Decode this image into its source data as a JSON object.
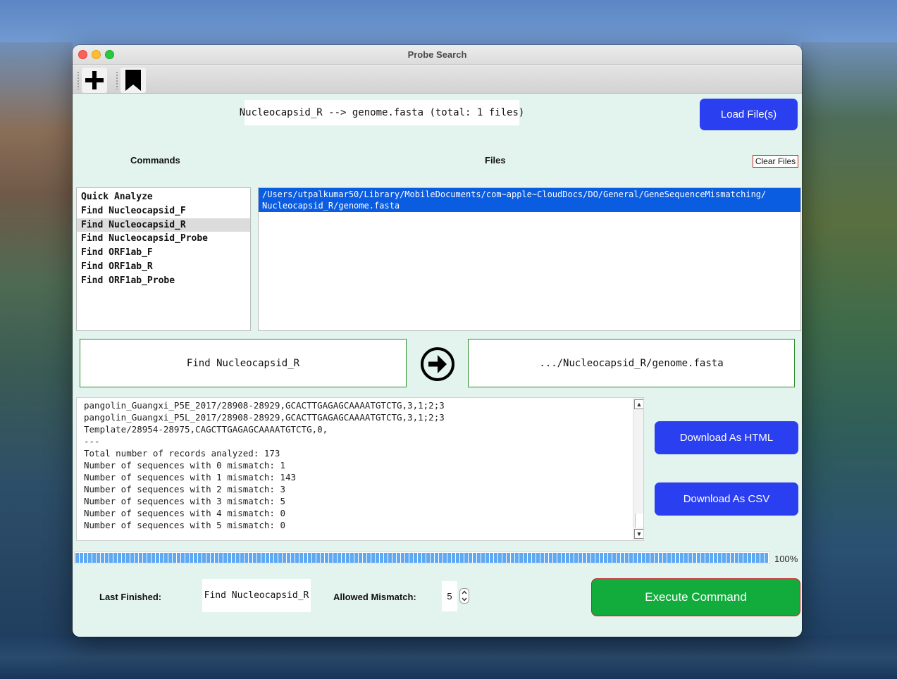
{
  "window": {
    "title": "Probe Search"
  },
  "toolbar": {
    "items": [
      {
        "icon": "plus-icon"
      },
      {
        "icon": "bookmark-icon"
      }
    ]
  },
  "status": {
    "text": "Nucleocapsid_R --> genome.fasta (total: 1 files)"
  },
  "buttons": {
    "load_files": "Load File(s)",
    "clear_files": "Clear Files",
    "download_html": "Download As HTML",
    "download_csv": "Download As CSV",
    "execute": "Execute Command"
  },
  "headings": {
    "commands": "Commands",
    "files": "Files"
  },
  "commands": [
    "Quick Analyze",
    "Find Nucleocapsid_F",
    "Find Nucleocapsid_R",
    "Find Nucleocapsid_Probe",
    "Find ORF1ab_F",
    "Find ORF1ab_R",
    "Find ORF1ab_Probe"
  ],
  "selected_command_index": 2,
  "files": [
    "/Users/utpalkumar50/Library/MobileDocuments/com~apple~CloudDocs/DO/General/GeneSequenceMismatching/ Nucleocapsid_R/genome.fasta"
  ],
  "selection": {
    "command": "Find Nucleocapsid_R",
    "file": ".../Nucleocapsid_R/genome.fasta"
  },
  "output": {
    "lines": [
      "pangolin_Guangxi_P5E_2017/28908-28929,GCACTTGAGAGCAAAATGTCTG,3,1;2;3",
      "pangolin_Guangxi_P5L_2017/28908-28929,GCACTTGAGAGCAAAATGTCTG,3,1;2;3",
      "Template/28954-28975,CAGCTTGAGAGCAAAATGTCTG,0,",
      "---",
      "Total number of records analyzed: 173",
      "Number of sequences with 0 mismatch: 1",
      "Number of sequences with 1 mismatch: 143",
      "Number of sequences with 2 mismatch: 3",
      "Number of sequences with 3 mismatch: 5",
      "Number of sequences with 4 mismatch: 0",
      "Number of sequences with 5 mismatch: 0"
    ]
  },
  "progress": {
    "value": 1.0,
    "label": "100%"
  },
  "footer": {
    "last_finished_label": "Last Finished:",
    "last_finished_value": "Find Nucleocapsid_R",
    "allowed_mismatch_label": "Allowed Mismatch:",
    "allowed_mismatch_value": "5"
  },
  "colors": {
    "accent_blue": "#2a3ff0",
    "execute_green": "#12ac3d",
    "selection_blue": "#0a5ce0",
    "window_bg": "#e3f4ee"
  }
}
